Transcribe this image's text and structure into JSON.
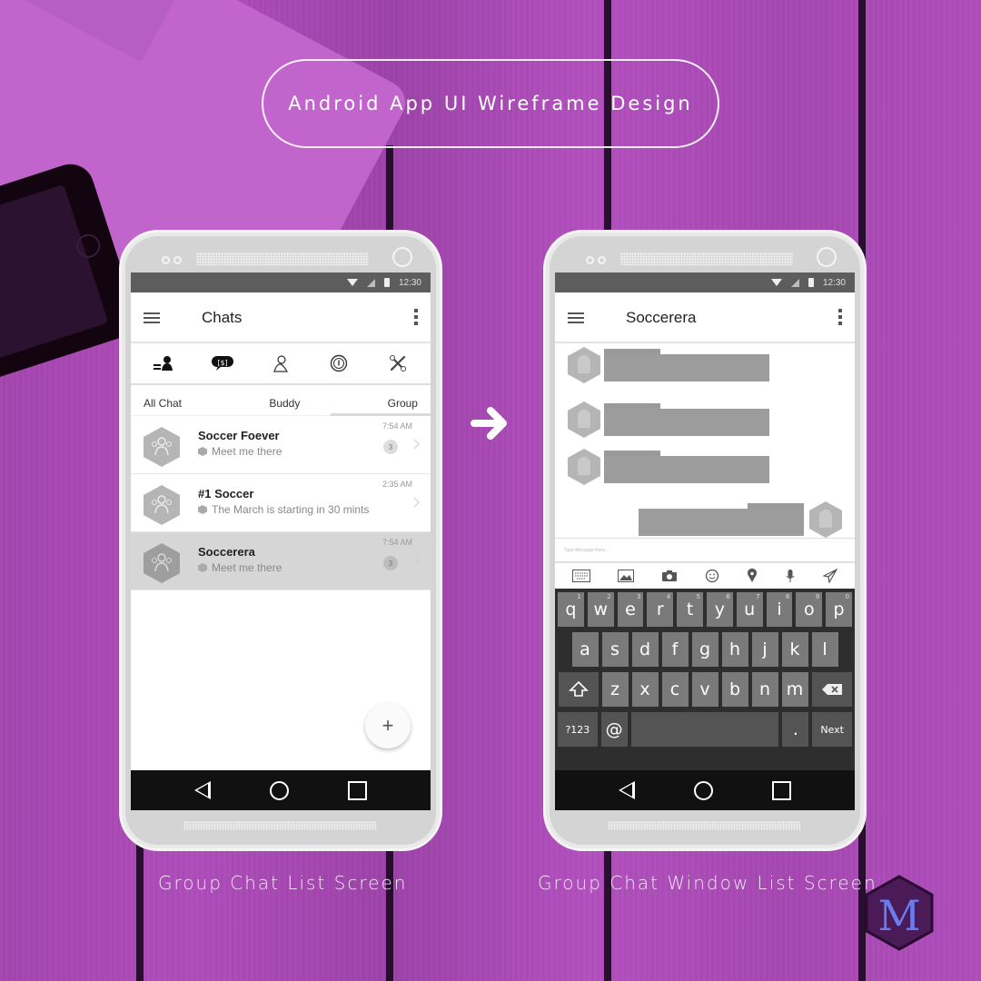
{
  "header": {
    "title": "Android App UI Wireframe Design"
  },
  "captions": {
    "left": "Group Chat List Screen",
    "right": "Group Chat Window List Screen"
  },
  "logo": {
    "letter": "M",
    "accent": "#6a7cf0"
  },
  "colors": {
    "background": "#aa4cb6",
    "status_bar": "#5d5d5d",
    "nav_bar": "#111111",
    "selected_row": "#d6d6d6"
  },
  "status": {
    "time": "12:30",
    "icons": [
      "wifi-icon",
      "signal-icon",
      "battery-icon"
    ]
  },
  "list_screen": {
    "title": "Chats",
    "icon_row": [
      "contacts-icon",
      "chat-bubble-icon",
      "profile-icon",
      "info-icon",
      "settings-tools-icon"
    ],
    "tabs": [
      "All Chat",
      "Buddy",
      "Group"
    ],
    "active_tab": "Group",
    "chats": [
      {
        "name": "Soccer Foever",
        "message": "Meet me there",
        "time": "7:54 AM",
        "badge": "3",
        "selected": false
      },
      {
        "name": "#1 Soccer",
        "message": "The March is starting in 30 mints",
        "time": "2:35 AM",
        "badge": "",
        "selected": false
      },
      {
        "name": "Soccerera",
        "message": "Meet me there",
        "time": "7:54 AM",
        "badge": "3",
        "selected": true
      }
    ],
    "fab_label": "+"
  },
  "chat_screen": {
    "title": "Soccerera",
    "input_placeholder": "Type Message Here...",
    "toolbar": [
      "keyboard-icon",
      "image-icon",
      "camera-icon",
      "emoji-icon",
      "location-icon",
      "microphone-icon",
      "send-icon"
    ],
    "keyboard": {
      "row1": [
        {
          "k": "q",
          "n": "1"
        },
        {
          "k": "w",
          "n": "2"
        },
        {
          "k": "e",
          "n": "3"
        },
        {
          "k": "r",
          "n": "4"
        },
        {
          "k": "t",
          "n": "5"
        },
        {
          "k": "y",
          "n": "6"
        },
        {
          "k": "u",
          "n": "7"
        },
        {
          "k": "i",
          "n": "8"
        },
        {
          "k": "o",
          "n": "9"
        },
        {
          "k": "p",
          "n": "0"
        }
      ],
      "row2": [
        "a",
        "s",
        "d",
        "f",
        "g",
        "h",
        "j",
        "k",
        "l"
      ],
      "row3": [
        "z",
        "x",
        "c",
        "v",
        "b",
        "n",
        "m"
      ],
      "symbols": "?123",
      "at": "@",
      "period": ".",
      "next": "Next"
    }
  }
}
